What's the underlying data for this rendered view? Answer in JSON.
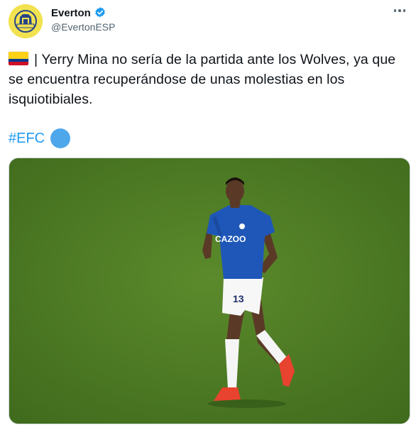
{
  "account": {
    "display_name": "Everton",
    "handle": "@EvertonESP",
    "avatar_icon": "everton-crest-icon",
    "verified_icon": "verified-badge-icon"
  },
  "menu": {
    "icon": "more-options-icon"
  },
  "tweet": {
    "flag_icon": "colombia-flag-icon",
    "text": "| Yerry Mina no sería de la partida ante los Wolves, ya que se encuentra recuperándose de unas molestias en los isquiotibiales.",
    "hashtag": "#EFC",
    "hashflag_icon": "everton-hashflag-icon"
  },
  "media": {
    "kind": "photo",
    "jersey_sponsor": "CAZOO",
    "jersey_number": "13"
  },
  "colors": {
    "link": "#1d9bf0",
    "verified": "#1d9bf0",
    "avatar_bg": "#f2e250",
    "everton_blue": "#274488",
    "pitch": "#4d7c23"
  }
}
